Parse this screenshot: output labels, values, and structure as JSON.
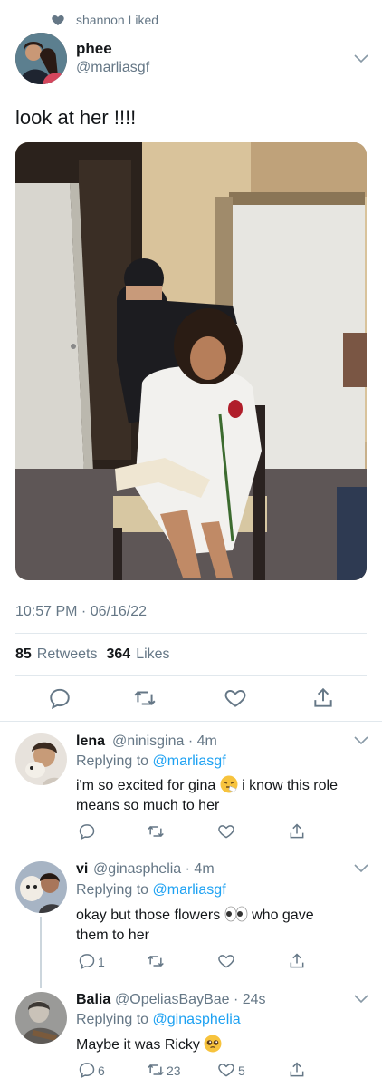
{
  "context": {
    "text": "shannon Liked",
    "icon": "heart-icon"
  },
  "tweet": {
    "display_name": "phee",
    "handle": "@marliasgf",
    "text": "look at her !!!!",
    "timestamp": "10:57 PM · 06/16/22",
    "retweets": "85",
    "retweets_label": "Retweets",
    "likes": "364",
    "likes_label": "Likes"
  },
  "replies": [
    {
      "name": "lena",
      "handle": "@ninisgina · 4m",
      "replying_prefix": "Replying to",
      "replying_to": "@marliasgf",
      "text_line1": "i'm so excited for gina",
      "text_line1_after": "i know this role",
      "text_line2": "means so much to her",
      "emoji": "sneezing-face-emoji",
      "reply_count": "",
      "retweet_count": "",
      "like_count": ""
    },
    {
      "name": "vi",
      "handle": "@ginasphelia · 4m",
      "replying_prefix": "Replying to",
      "replying_to": "@marliasgf",
      "text_line1": "okay but those flowers",
      "text_line1_after": "who gave",
      "text_line2": "them to her",
      "emoji": "eyes-emoji",
      "reply_count": "1",
      "retweet_count": "",
      "like_count": ""
    },
    {
      "name": "Balia",
      "handle": "@OpeliasBayBae · 24s",
      "replying_prefix": "Replying to",
      "replying_to": "@ginasphelia",
      "text_line1": "Maybe it was Ricky",
      "emoji": "pleading-face-emoji",
      "reply_count": "6",
      "retweet_count": "23",
      "like_count": "5"
    }
  ],
  "colors": {
    "link": "#1da1f2",
    "muted": "#657786",
    "divider": "#e1e8ed"
  }
}
